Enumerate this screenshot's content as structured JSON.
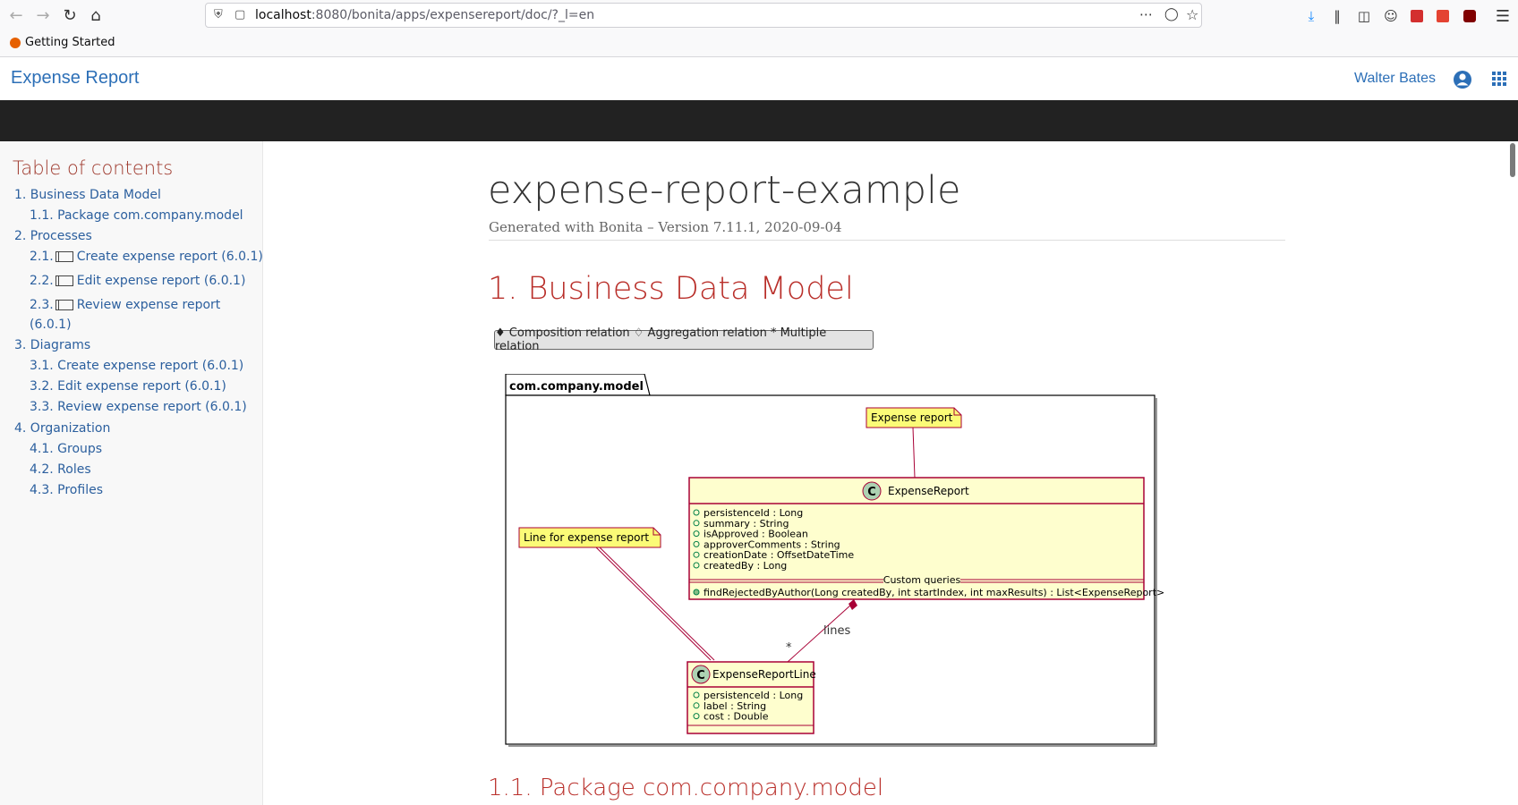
{
  "browser": {
    "url_host": "localhost",
    "url_rest": ":8080/bonita/apps/expensereport/doc/?_l=en",
    "bookmark": "Getting Started"
  },
  "app": {
    "title": "Expense Report",
    "user": "Walter Bates"
  },
  "toc": {
    "title": "Table of contents",
    "items": [
      {
        "label": "1. Business Data Model"
      },
      {
        "label": "1.1. Package com.company.model"
      },
      {
        "label": "2. Processes"
      },
      {
        "num": "2.1.",
        "label": "Create expense report (6.0.1)"
      },
      {
        "num": "2.2.",
        "label": "Edit expense report (6.0.1)"
      },
      {
        "num": "2.3.",
        "label": "Review expense report",
        "label2": "(6.0.1)"
      },
      {
        "label": "3. Diagrams"
      },
      {
        "label": "3.1. Create expense report (6.0.1)"
      },
      {
        "label": "3.2. Edit expense report (6.0.1)"
      },
      {
        "label": "3.3. Review expense report (6.0.1)"
      },
      {
        "label": "4. Organization"
      },
      {
        "label": "4.1. Groups"
      },
      {
        "label": "4.2. Roles"
      },
      {
        "label": "4.3. Profiles"
      }
    ]
  },
  "doc": {
    "title": "expense-report-example",
    "subtitle": "Generated with Bonita – Version 7.11.1, 2020-09-04",
    "section1": "1. Business Data Model",
    "legend": "♦ Composition relation ♢ Aggregation relation * Multiple relation",
    "section11": "1.1. Package com.company.model"
  },
  "diagram": {
    "package": "com.company.model",
    "note_expense": "Expense report",
    "note_line": "Line for expense report",
    "class1": {
      "name": "ExpenseReport",
      "attributes": [
        "persistenceId : Long",
        "summary : String",
        "isApproved : Boolean",
        "approverComments : String",
        "creationDate : OffsetDateTime",
        "createdBy : Long"
      ],
      "queries_label": "Custom queries",
      "query": "findRejectedByAuthor(Long createdBy, int startIndex, int maxResults) : List<ExpenseReport>"
    },
    "class2": {
      "name": "ExpenseReportLine",
      "attributes": [
        "persistenceId : Long",
        "label : String",
        "cost : Double"
      ]
    },
    "relation_label": "lines",
    "multiplicity": "*"
  }
}
